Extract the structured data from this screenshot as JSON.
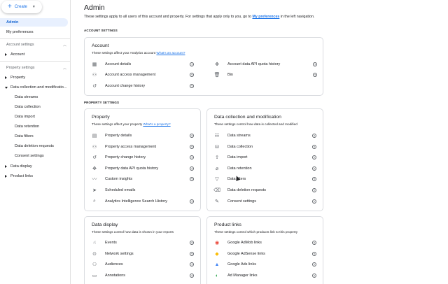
{
  "sidebar": {
    "create_label": "Create",
    "items": {
      "admin": "Admin",
      "my_preferences": "My preferences",
      "account_settings": "Account settings",
      "account": "Account",
      "property_settings": "Property settings",
      "property": "Property",
      "data_collection_modification": "Data collection and modificatio...",
      "data_streams": "Data streams",
      "data_collection": "Data collection",
      "data_import": "Data import",
      "data_retention": "Data retention",
      "data_filters": "Data filters",
      "data_deletion_requests": "Data deletion requests",
      "consent_settings": "Consent settings",
      "data_display": "Data display",
      "product_links": "Product links"
    }
  },
  "main": {
    "title": "Admin",
    "desc_prefix": "These settings apply to all users of this account and property. For settings that apply only to you, go to ",
    "desc_link": "My preferences",
    "desc_suffix": " in the left navigation.",
    "account_settings_label": "ACCOUNT SETTINGS",
    "property_settings_label": "PROPERTY SETTINGS",
    "account_card": {
      "title": "Account",
      "desc": "These settings affect your Analytics account ",
      "link": "What's an account?",
      "left": [
        "Account details",
        "Account access management",
        "Account change history"
      ],
      "right": [
        "Account data API quota history",
        "Bin"
      ]
    },
    "property_card": {
      "title": "Property",
      "desc": "These settings affect your property ",
      "link": "What's a property?",
      "items": [
        "Property details",
        "Property access management",
        "Property change history",
        "Property data API quota history",
        "Custom insights",
        "Scheduled emails",
        "Analytics Intelligence Search History"
      ]
    },
    "dcm_card": {
      "title": "Data collection and modification",
      "desc": "These settings control how data is collected and modified",
      "items": [
        "Data streams",
        "Data collection",
        "Data import",
        "Data retention",
        "Data filters",
        "Data deletion requests",
        "Consent settings"
      ]
    },
    "display_card": {
      "title": "Data display",
      "desc": "These settings control how data is shown in your reports",
      "items": [
        "Events",
        "Network settings",
        "Audiences",
        "Annotations"
      ]
    },
    "links_card": {
      "title": "Product links",
      "desc": "These settings control which products link to this property",
      "items": [
        "Google AdMob links",
        "Google AdSense links",
        "Google Ads links",
        "Ad Manager links"
      ]
    },
    "help_glyph": "?"
  },
  "icons": {
    "plus": "+",
    "caret": "▼",
    "chevron_up": "︿"
  },
  "colors": {
    "accent": "#1a73e8",
    "active_bg": "#e8f0fe",
    "border": "#dadce0"
  }
}
